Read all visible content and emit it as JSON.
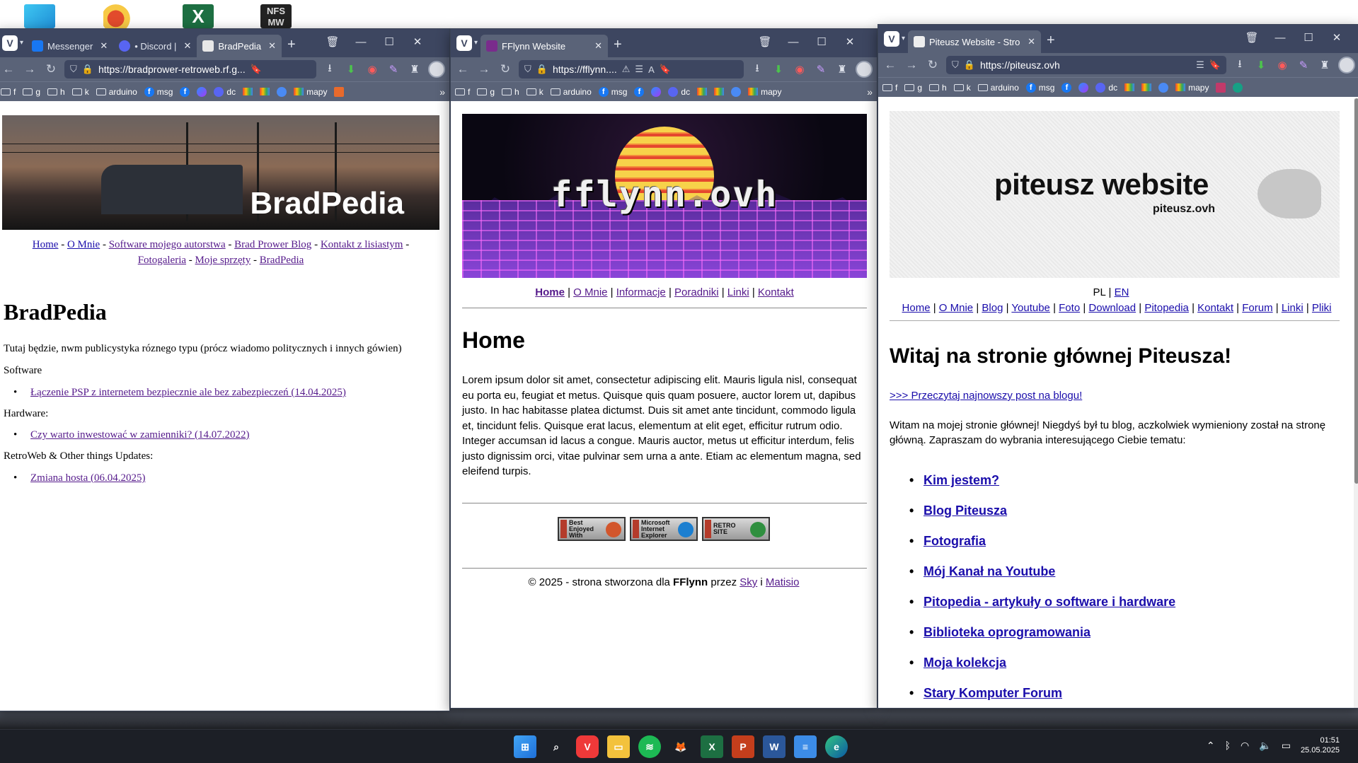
{
  "desktop": {
    "icons": [
      "monitor-icon",
      "fruit-app-icon",
      "excel-icon",
      "nfs-mw-icon"
    ],
    "nfs_label": "NFS\nMW"
  },
  "win1": {
    "tabs": [
      {
        "label": "Messenger",
        "icon": "messenger-icon"
      },
      {
        "label": "• Discord |",
        "icon": "discord-icon"
      },
      {
        "label": "BradPedia",
        "icon": "page-icon",
        "active": true
      }
    ],
    "url": "https://bradprower-retroweb.rf.g...",
    "bookmarks": [
      "f",
      "g",
      "h",
      "k",
      "arduino",
      "msg",
      "",
      "",
      "dc",
      "",
      "",
      "",
      "mapy",
      ""
    ],
    "banner_title": "BradPedia",
    "nav": [
      "Home",
      "O Mnie",
      "Software mojego autorstwa",
      "Brad Prower Blog",
      "Kontakt z lisiastym",
      "Fotogaleria",
      "Moje sprzęty",
      "BradPedia"
    ],
    "nav_sep": "-",
    "heading": "BradPedia",
    "intro": "Tutaj będzie, nwm publicystyka róznego typu (prócz wiadomo politycznych i innych gówien)",
    "sections": [
      {
        "title": "Software",
        "items": [
          "Łączenie PSP z internetem bezpiecznie ale bez zabezpieczeń (14.04.2025)"
        ]
      },
      {
        "title": "Hardware:",
        "items": [
          "Czy warto inwestować w zamienniki? (14.07.2022)"
        ]
      },
      {
        "title": "RetroWeb & Other things Updates:",
        "items": [
          "Zmiana hosta (06.04.2025)"
        ]
      }
    ]
  },
  "win2": {
    "tab": "FFlynn Website",
    "url": "https://fflynn....",
    "bookmarks": [
      "f",
      "g",
      "h",
      "k",
      "arduino",
      "msg",
      "dc",
      "mapy"
    ],
    "logo": "fflynn.ovh",
    "nav": [
      "Home",
      "O Mnie",
      "Informacje",
      "Poradniki",
      "Linki",
      "Kontakt"
    ],
    "nav_sep": "|",
    "heading": "Home",
    "paragraph": "Lorem ipsum dolor sit amet, consectetur adipiscing elit. Mauris ligula nisl, consequat eu porta eu, feugiat et metus. Quisque quis quam posuere, auctor lorem ut, dapibus justo. In hac habitasse platea dictumst. Duis sit amet ante tincidunt, commodo ligula et, tincidunt felis. Quisque erat lacus, elementum at elit eget, efficitur rutrum odio. Integer accumsan id lacus a congue. Mauris auctor, metus ut efficitur interdum, felis justo dignissim orci, vitae pulvinar sem urna a ante. Etiam ac elementum magna, sed eleifend turpis.",
    "badges": [
      "Best Enjoyed With",
      "Microsoft Internet Explorer",
      "RETRO SITE"
    ],
    "footer": {
      "prefix": "© 2025 - strona stworzona dla ",
      "bold": "FFlynn",
      "mid": " przez ",
      "link1": "Sky",
      "and": " i ",
      "link2": "Matisio"
    }
  },
  "win3": {
    "tab": "Piteusz Website - Strona",
    "url": "https://piteusz.ovh",
    "bookmarks": [
      "f",
      "g",
      "h",
      "k",
      "arduino",
      "msg",
      "dc",
      "mapy"
    ],
    "banner_title": "piteusz website",
    "banner_sub": "piteusz.ovh",
    "lang": {
      "pl": "PL",
      "sep": "|",
      "en": "EN"
    },
    "nav": [
      "Home",
      "O Mnie",
      "Blog",
      "Youtube",
      "Foto",
      "Download",
      "Pitopedia",
      "Kontakt",
      "Forum",
      "Linki",
      "Pliki"
    ],
    "nav_sep": "|",
    "heading": "Witaj na stronie głównej Piteusza!",
    "latest_link": ">>> Przeczytaj najnowszy post na blogu!",
    "paragraph": "Witam na mojej stronie głównej! Niegdyś był tu blog, aczkolwiek wymieniony został na stronę główną. Zapraszam do wybrania interesującego Ciebie tematu:",
    "items": [
      "Kim jestem?",
      "Blog Piteusza",
      "Fotografia",
      "Mój Kanał na Youtube",
      "Pitopedia - artykuły o software i hardware",
      "Biblioteka oprogramowania",
      "Moja kolekcja",
      "Stary Komputer Forum"
    ]
  },
  "taskbar": {
    "apps": [
      "start-icon",
      "search-icon",
      "vivaldi-icon",
      "explorer-icon",
      "spotify-icon",
      "firefox-icon",
      "excel-icon",
      "powerpoint-icon",
      "word-icon",
      "notepad-icon",
      "edge-icon"
    ],
    "time": "01:51",
    "date": "25.05.2025"
  }
}
